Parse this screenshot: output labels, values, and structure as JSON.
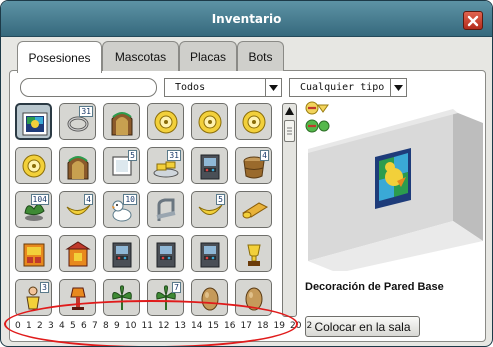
{
  "window": {
    "title": "Inventario"
  },
  "tabs": [
    {
      "label": "Posesiones",
      "active": true
    },
    {
      "label": "Mascotas",
      "active": false
    },
    {
      "label": "Placas",
      "active": false
    },
    {
      "label": "Bots",
      "active": false
    }
  ],
  "filters": {
    "search_value": "",
    "category": "Todos",
    "type": "Cualquier tipo"
  },
  "grid": {
    "rows": [
      [
        {
          "icon": "painting-icon",
          "count": "",
          "selected": true
        },
        {
          "icon": "ring-icon",
          "count": "31"
        },
        {
          "icon": "arch-door-icon",
          "count": ""
        },
        {
          "icon": "gold-disc-icon",
          "count": ""
        },
        {
          "icon": "gold-disc-icon",
          "count": ""
        },
        {
          "icon": "gold-disc-icon",
          "count": ""
        }
      ],
      [
        {
          "icon": "gold-disc-icon",
          "count": ""
        },
        {
          "icon": "arch-door-icon",
          "count": ""
        },
        {
          "icon": "screen-icon",
          "count": "5"
        },
        {
          "icon": "gold-bars-icon",
          "count": "31"
        },
        {
          "icon": "arcade-icon",
          "count": ""
        },
        {
          "icon": "barrel-icon",
          "count": "4"
        }
      ],
      [
        {
          "icon": "plant-pot-icon",
          "count": "104"
        },
        {
          "icon": "banana-icon",
          "count": "4"
        },
        {
          "icon": "duck-icon",
          "count": "10"
        },
        {
          "icon": "chair-icon",
          "count": ""
        },
        {
          "icon": "banana-icon",
          "count": "5"
        },
        {
          "icon": "mat-roll-icon",
          "count": ""
        }
      ],
      [
        {
          "icon": "cabinet-icon",
          "count": ""
        },
        {
          "icon": "shrine-icon",
          "count": ""
        },
        {
          "icon": "arcade-icon",
          "count": ""
        },
        {
          "icon": "arcade-icon",
          "count": ""
        },
        {
          "icon": "arcade-icon",
          "count": ""
        },
        {
          "icon": "trophy-icon",
          "count": ""
        }
      ],
      [
        {
          "icon": "figure-icon",
          "count": "3"
        },
        {
          "icon": "lamp-icon",
          "count": ""
        },
        {
          "icon": "plant-icon",
          "count": ""
        },
        {
          "icon": "plant-icon",
          "count": "7"
        },
        {
          "icon": "egg-icon",
          "count": ""
        },
        {
          "icon": "egg-icon",
          "count": ""
        }
      ]
    ]
  },
  "pagination": [
    "0",
    "1",
    "2",
    "3",
    "4",
    "5",
    "6",
    "7",
    "8",
    "9",
    "10",
    "11",
    "12",
    "13",
    "14",
    "15",
    "16",
    "17",
    "18",
    "19",
    "20",
    "2"
  ],
  "details": {
    "name": "Decoración de Pared Base",
    "place_label": "Colocar en la sala"
  },
  "colors": {
    "titlebar": "#4a8196",
    "annotation": "#e01b1b",
    "count_border": "#5a7a8a"
  }
}
